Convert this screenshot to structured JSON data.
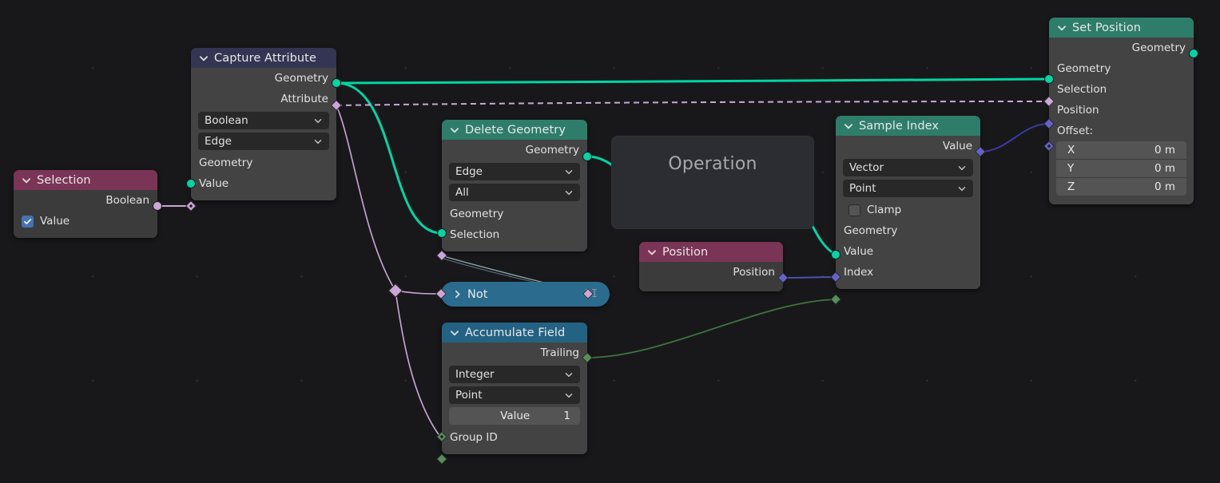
{
  "editor": {
    "name": "blender-geometry-node-editor",
    "background_color": "#18181b"
  },
  "colors": {
    "geometry_socket": "#00d6a3",
    "boolean_socket": "#cca6d6",
    "vector_socket": "#6363c7",
    "integer_socket": "#598c5c",
    "header_geometry": "#2e7d6b",
    "header_attribute": "#343552",
    "header_input": "#7a3456",
    "header_field": "#246283",
    "node_body": "#434343",
    "checkbox_on": "#4772b3"
  },
  "nodes": {
    "selection": {
      "title": "Selection",
      "header_color": "#7a3456",
      "outputs": [
        {
          "label": "Boolean",
          "socket": "boolean-socket"
        }
      ],
      "checkbox": {
        "label": "Value",
        "checked": true
      }
    },
    "capture_attribute": {
      "title": "Capture Attribute",
      "header_color": "#343552",
      "outputs": [
        {
          "label": "Geometry",
          "socket": "geometry-socket"
        },
        {
          "label": "Attribute",
          "socket": "boolean-socket"
        }
      ],
      "dropdowns": [
        "Boolean",
        "Edge"
      ],
      "inputs": [
        {
          "label": "Geometry",
          "socket": "geometry-socket"
        },
        {
          "label": "Value",
          "socket": "boolean-socket"
        }
      ]
    },
    "delete_geometry": {
      "title": "Delete Geometry",
      "header_color": "#2e7d6b",
      "outputs": [
        {
          "label": "Geometry",
          "socket": "geometry-socket"
        }
      ],
      "dropdowns": [
        "Edge",
        "All"
      ],
      "inputs": [
        {
          "label": "Geometry",
          "socket": "geometry-socket"
        },
        {
          "label": "Selection",
          "socket": "boolean-socket"
        }
      ]
    },
    "not_node": {
      "title": "Not",
      "collapsed": true,
      "header_color": "#2b6c8e",
      "mute_icon": "II"
    },
    "accumulate_field": {
      "title": "Accumulate Field",
      "header_color": "#246283",
      "outputs": [
        {
          "label": "Trailing",
          "socket": "integer-socket"
        }
      ],
      "dropdowns": [
        "Integer",
        "Point"
      ],
      "value_field": {
        "label": "Value",
        "value": "1"
      },
      "inputs": [
        {
          "label": "Group ID",
          "socket": "integer-socket"
        }
      ]
    },
    "operation_frame": {
      "label": "Operation"
    },
    "position": {
      "title": "Position",
      "header_color": "#7a3456",
      "outputs": [
        {
          "label": "Position",
          "socket": "vector-socket"
        }
      ]
    },
    "sample_index": {
      "title": "Sample Index",
      "header_color": "#2e7d6b",
      "outputs": [
        {
          "label": "Value",
          "socket": "vector-socket"
        }
      ],
      "dropdowns": [
        "Vector",
        "Point"
      ],
      "checkbox": {
        "label": "Clamp",
        "checked": false
      },
      "inputs": [
        {
          "label": "Geometry",
          "socket": "geometry-socket"
        },
        {
          "label": "Value",
          "socket": "vector-socket"
        },
        {
          "label": "Index",
          "socket": "integer-socket"
        }
      ]
    },
    "set_position": {
      "title": "Set Position",
      "header_color": "#2e7d6b",
      "outputs": [
        {
          "label": "Geometry",
          "socket": "geometry-socket"
        }
      ],
      "inputs": [
        {
          "label": "Geometry",
          "socket": "geometry-socket"
        },
        {
          "label": "Selection",
          "socket": "boolean-socket"
        },
        {
          "label": "Position",
          "socket": "vector-socket"
        },
        {
          "label": "Offset:",
          "socket": "vector-socket-field"
        }
      ],
      "offset_values": [
        {
          "axis": "X",
          "value": "0 m"
        },
        {
          "axis": "Y",
          "value": "0 m"
        },
        {
          "axis": "Z",
          "value": "0 m"
        }
      ]
    }
  }
}
